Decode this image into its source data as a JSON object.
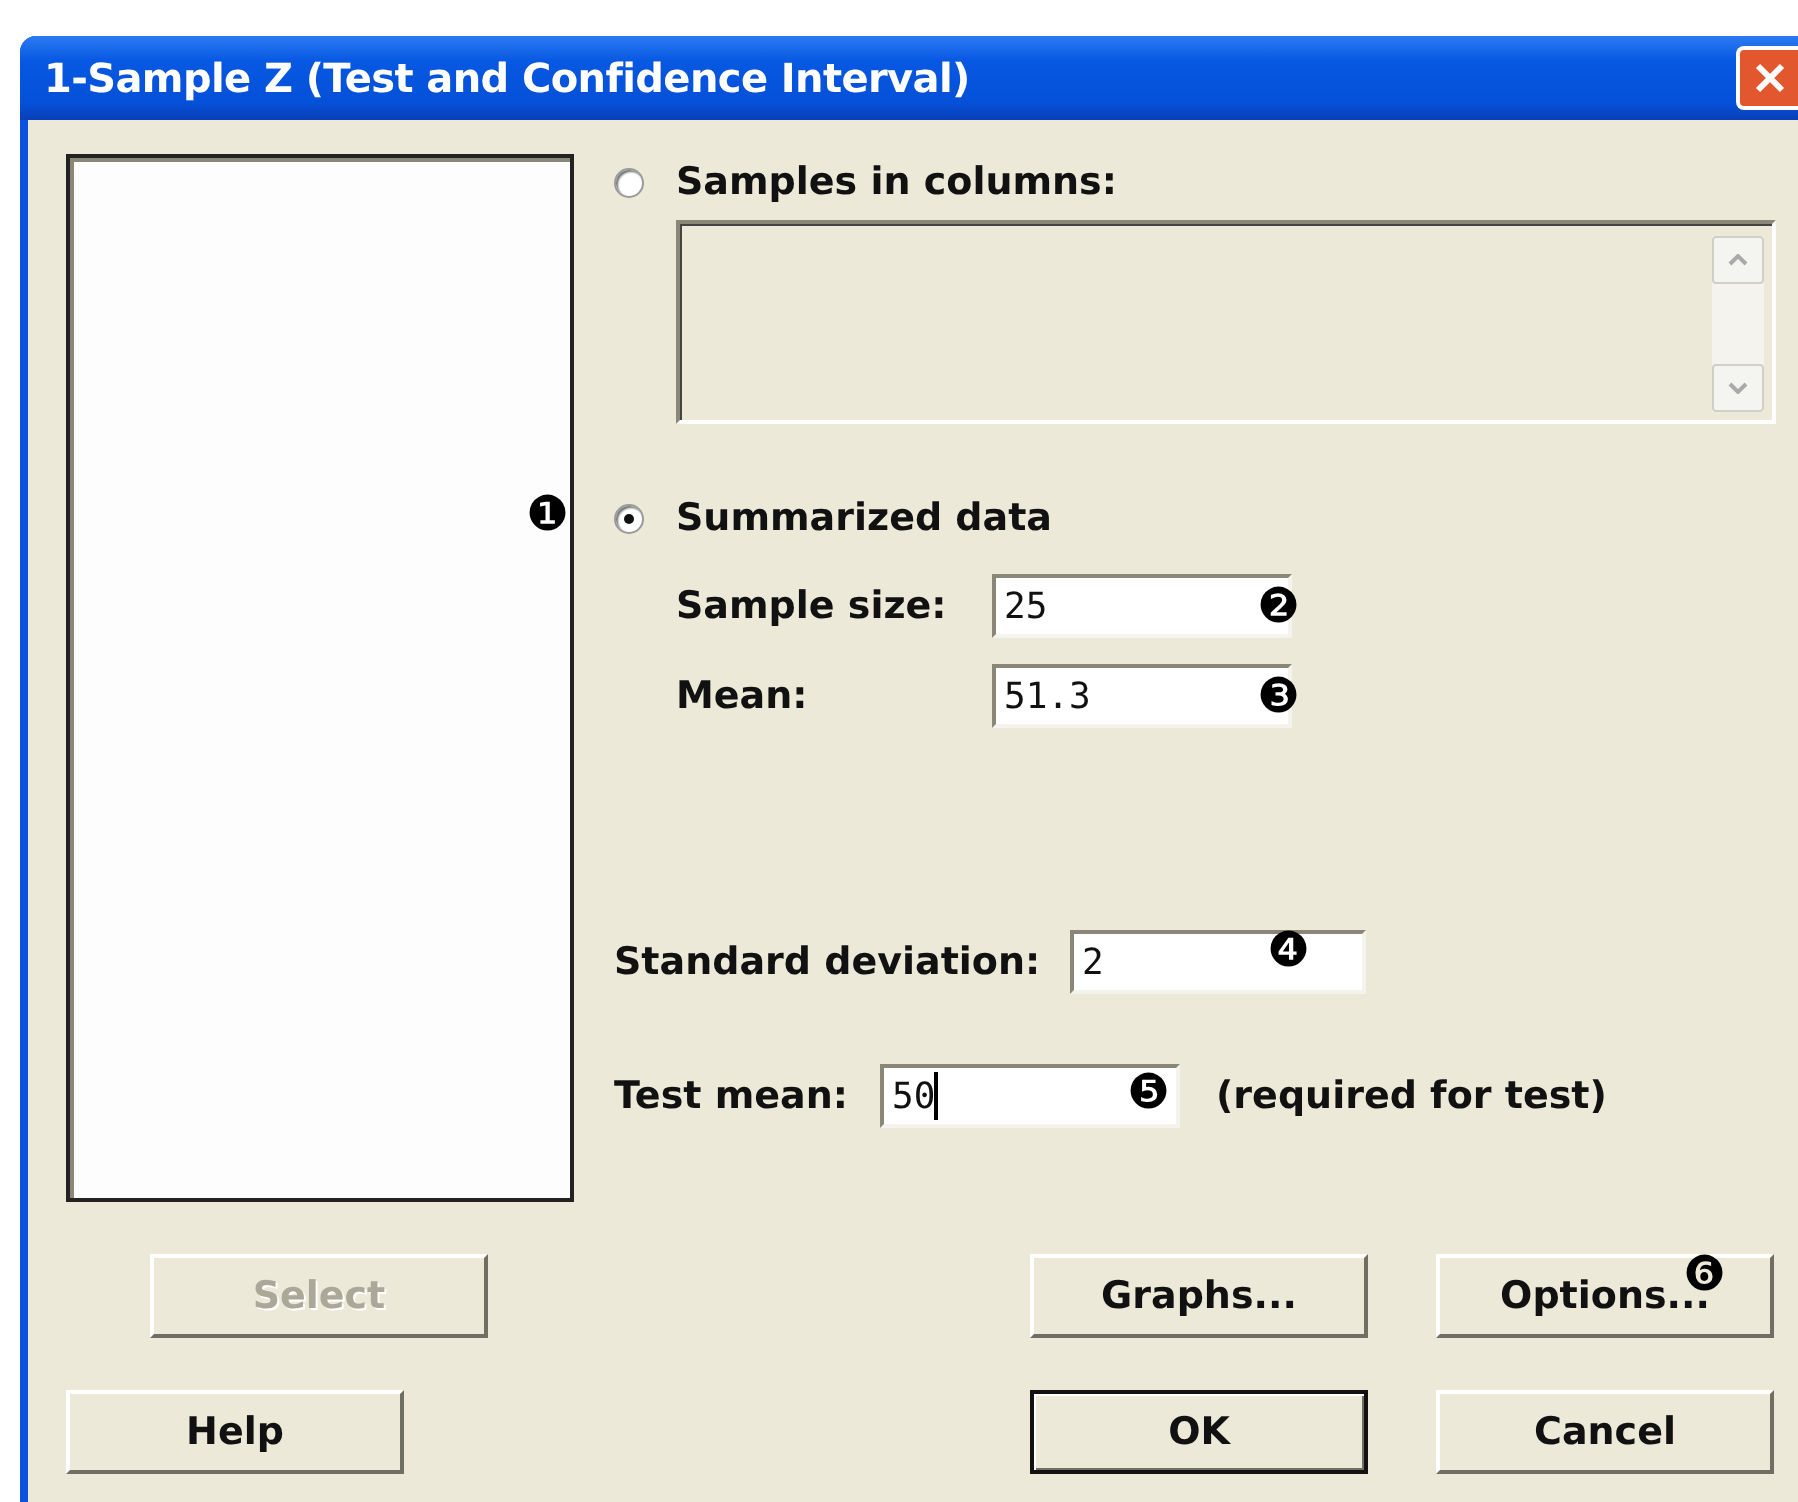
{
  "window": {
    "title": "1-Sample Z (Test and Confidence Interval)"
  },
  "options": [
    {
      "label": "Samples in columns:",
      "selected": false
    },
    {
      "label": "Summarized data",
      "selected": true,
      "callout": "❶"
    }
  ],
  "summarized_fields": [
    {
      "label": "Sample size:",
      "value": "25",
      "callout": "❷"
    },
    {
      "label": "Mean:",
      "value": "51.3",
      "callout": "❸"
    }
  ],
  "standard_deviation": {
    "label": "Standard deviation:",
    "value": "2",
    "callout": "❹"
  },
  "test_mean": {
    "label": "Test mean:",
    "value": "50",
    "callout": "❺",
    "focused": true,
    "note": "(required for test)"
  },
  "buttons": [
    {
      "label": "Select",
      "kind": "select",
      "disabled": true
    },
    {
      "label": "Graphs...",
      "kind": "graphs",
      "disabled": false
    },
    {
      "label": "Options...",
      "kind": "options",
      "disabled": false,
      "callout": "❻"
    },
    {
      "label": "Help",
      "kind": "help",
      "disabled": false
    },
    {
      "label": "OK",
      "kind": "ok",
      "disabled": false,
      "default": true
    },
    {
      "label": "Cancel",
      "kind": "cancel",
      "disabled": false
    }
  ]
}
